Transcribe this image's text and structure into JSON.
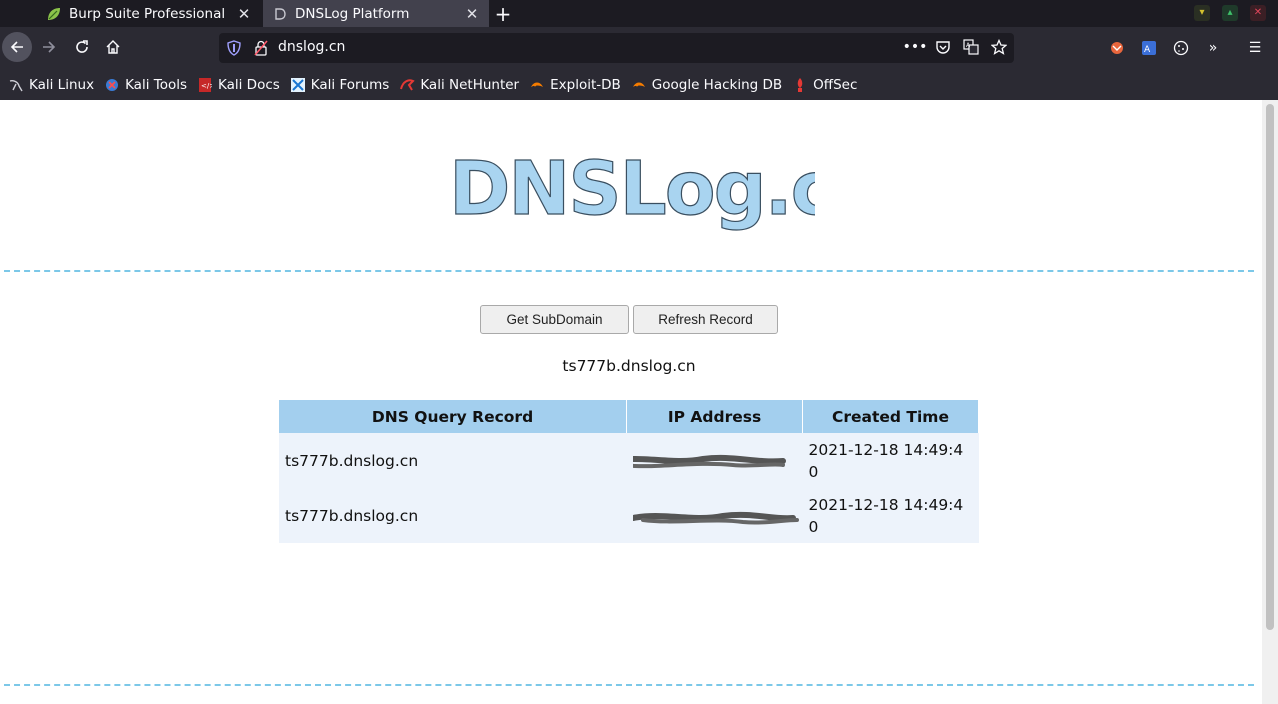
{
  "tabs": [
    {
      "title": "Burp Suite Professional",
      "icon": "burp-leaf-icon",
      "active": false
    },
    {
      "title": "DNSLog Platform",
      "icon": "dnslog-d-icon",
      "active": true
    }
  ],
  "address_bar": {
    "url": "dnslog.cn"
  },
  "bookmarks": [
    {
      "label": "Kali Linux",
      "icon": "kali-dragon-icon"
    },
    {
      "label": "Kali Tools",
      "icon": "kali-tools-icon"
    },
    {
      "label": "Kali Docs",
      "icon": "kali-docs-icon"
    },
    {
      "label": "Kali Forums",
      "icon": "kali-forums-icon"
    },
    {
      "label": "Kali NetHunter",
      "icon": "nethunter-icon"
    },
    {
      "label": "Exploit-DB",
      "icon": "exploit-db-icon"
    },
    {
      "label": "Google Hacking DB",
      "icon": "ghdb-icon"
    },
    {
      "label": "OffSec",
      "icon": "offsec-icon"
    }
  ],
  "page": {
    "logo_text": "DNSLog.cn",
    "buttons": {
      "get_subdomain": "Get SubDomain",
      "refresh_record": "Refresh Record"
    },
    "subdomain": "ts777b.dnslog.cn",
    "table": {
      "headers": [
        "DNS Query Record",
        "IP Address",
        "Created Time"
      ],
      "rows": [
        {
          "dns": "ts777b.dnslog.cn",
          "ip": "[redacted]",
          "time": "2021-12-18 14:49:40"
        },
        {
          "dns": "ts777b.dnslog.cn",
          "ip": "[redacted]",
          "time": "2021-12-18 14:49:40"
        }
      ]
    }
  },
  "colors": {
    "tab_bar": "#1c1b22",
    "toolbar": "#2b2a33",
    "active_tab": "#42414d",
    "table_header": "#a3cfee",
    "table_row": "#edf3fb",
    "separator": "#7cc8e8",
    "logo": "#a9d4f0"
  }
}
